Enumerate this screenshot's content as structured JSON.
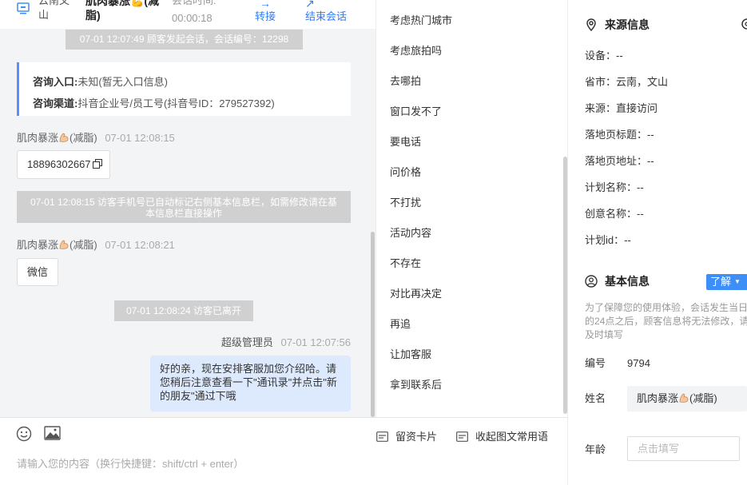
{
  "header": {
    "location": "云南文山",
    "visitor_name": "肌肉暴涨💪(减脂)",
    "duration_label": "会话时间:",
    "duration_value": "00:00:18",
    "transfer_label": "转接",
    "end_label": "结束会话"
  },
  "chat": {
    "system_start": "07-01 12:07:49 顾客发起会话，会话编号：12298",
    "consult_entry_key": "咨询入口:",
    "consult_entry_value": "未知(暂无入口信息)",
    "consult_channel_key": "咨询渠道:",
    "consult_channel_value": "抖音企业号/员工号(抖音号ID：279527392)",
    "msg1_sender": "肌肉暴涨",
    "msg1_sender_suffix": "(减脂)",
    "msg1_time": "07-01 12:08:15",
    "msg1_text": "18896302667",
    "system_phone": "07-01 12:08:15 访客手机号已自动标记右侧基本信息栏，如需修改请在基本信息栏直接操作",
    "msg2_sender": "肌肉暴涨",
    "msg2_sender_suffix": "(减脂)",
    "msg2_time": "07-01 12:08:21",
    "msg2_text": "微信",
    "system_left": "07-01 12:08:24 访客已离开",
    "agent_name": "超级管理员",
    "agent_time": "07-01 12:07:56",
    "agent_text": "好的亲，现在安排客服加您介绍哈。请您稍后注意查看一下\"通讯录\"并点击\"新的朋友\"通过下哦"
  },
  "composer": {
    "leave_card_label": "留资卡片",
    "collect_label": "收起图文常用语",
    "placeholder": "请输入您的内容（换行快捷键：shift/ctrl + enter）"
  },
  "quick_replies": [
    "考虑热门城市",
    "考虑旅拍吗",
    "去哪拍",
    "窗口发不了",
    "要电话",
    "问价格",
    "不打扰",
    "活动内容",
    "不存在",
    "对比再决定",
    "再追",
    "让加客服",
    "拿到联系后"
  ],
  "source_info": {
    "title": "来源信息",
    "device": "设备：--",
    "city": "省市：云南，文山",
    "source": "来源：直接访问",
    "landing_title": "落地页标题：--",
    "landing_url": "落地页地址：--",
    "plan_name": "计划名称：--",
    "creative_name": "创意名称：--",
    "plan_id": "计划id：--"
  },
  "basic_info": {
    "title": "基本信息",
    "learn_more": "了解",
    "note": "为了保障您的使用体验，会话发生当日的24点之后，顾客信息将无法修改，请及时填写",
    "number_label": "编号",
    "number_value": "9794",
    "name_label": "姓名",
    "name_value": "肌肉暴涨",
    "name_suffix": "(减脂)",
    "age_label": "年龄",
    "age_placeholder": "点击填写"
  }
}
